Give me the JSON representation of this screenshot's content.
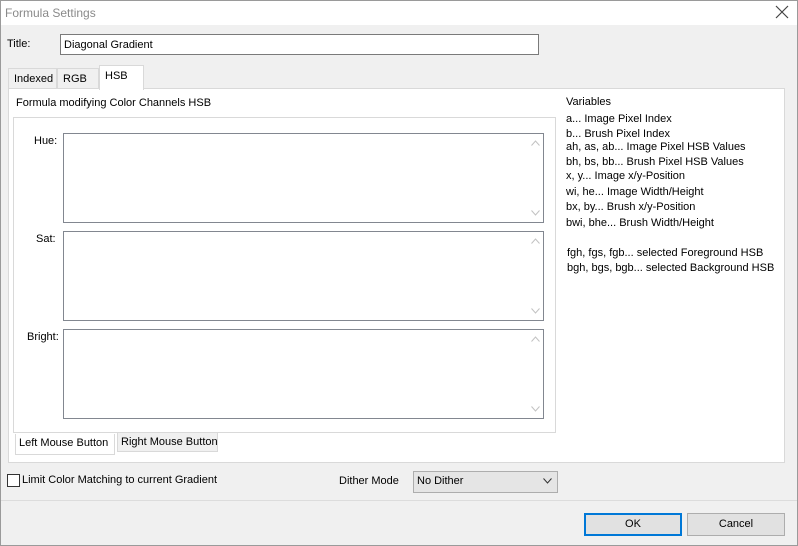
{
  "window": {
    "title": "Formula Settings",
    "close_icon": "close-icon"
  },
  "title_field": {
    "label": "Title:",
    "value": "Diagonal Gradient"
  },
  "tabs": [
    {
      "label": "Indexed"
    },
    {
      "label": "RGB"
    },
    {
      "label": "HSB",
      "active": true
    }
  ],
  "formula_section": {
    "heading": "Formula modifying Color Channels HSB",
    "fields": [
      {
        "label": "Hue:",
        "value": ""
      },
      {
        "label": "Sat:",
        "value": ""
      },
      {
        "label": "Bright:",
        "value": ""
      }
    ],
    "mouse_tabs": [
      {
        "label": "Left Mouse Button",
        "active": true
      },
      {
        "label": "Right Mouse Button"
      }
    ]
  },
  "variables": {
    "heading": "Variables",
    "items": [
      "a... Image Pixel Index",
      "b... Brush Pixel Index",
      "ah, as, ab... Image Pixel HSB Values",
      "bh, bs, bb... Brush Pixel HSB Values",
      "x, y... Image x/y-Position",
      "wi, he... Image Width/Height",
      "bx, by... Brush x/y-Position",
      "bwi, bhe... Brush Width/Height",
      "fgh, fgs, fgb... selected Foreground HSB",
      "bgh, bgs, bgb... selected Background HSB"
    ]
  },
  "limit_checkbox": {
    "label": "Limit Color Matching to current Gradient",
    "checked": false
  },
  "dither": {
    "label": "Dither Mode",
    "value": "No Dither"
  },
  "buttons": {
    "ok": "OK",
    "cancel": "Cancel"
  }
}
